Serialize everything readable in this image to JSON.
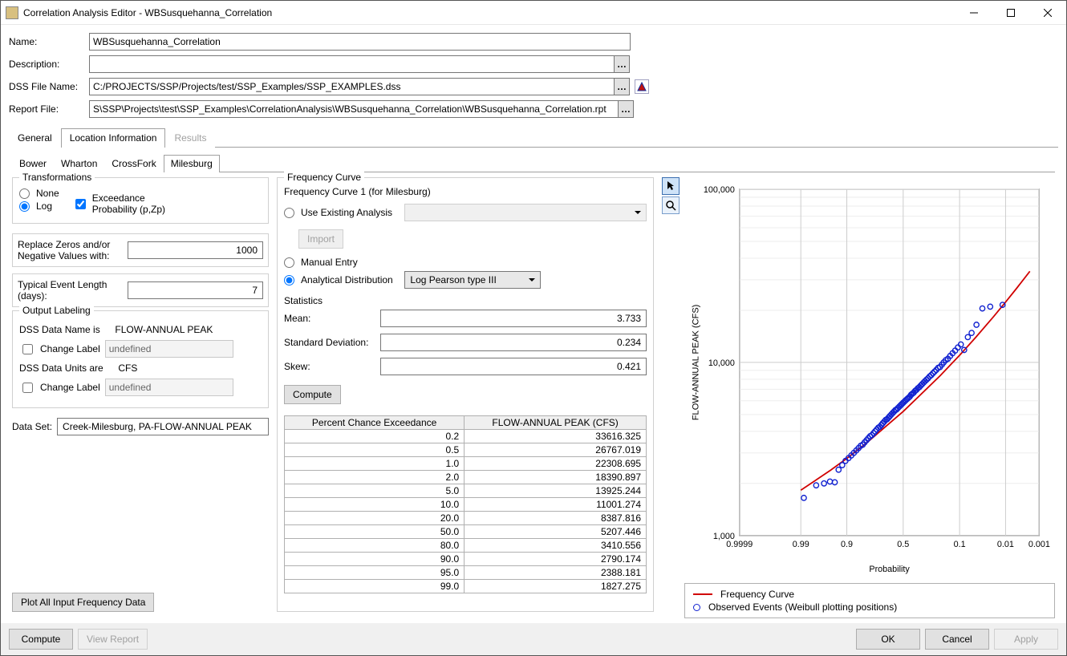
{
  "window": {
    "title": "Correlation Analysis Editor - WBSusquehanna_Correlation"
  },
  "form": {
    "name_label": "Name:",
    "name_value": "WBSusquehanna_Correlation",
    "desc_label": "Description:",
    "desc_value": "",
    "dss_label": "DSS File Name:",
    "dss_value": "C:/PROJECTS/SSP/Projects/test/SSP_Examples/SSP_EXAMPLES.dss",
    "report_label": "Report File:",
    "report_value": "S\\SSP\\Projects\\test\\SSP_Examples\\CorrelationAnalysis\\WBSusquehanna_Correlation\\WBSusquehanna_Correlation.rpt"
  },
  "tabs": {
    "general": "General",
    "location": "Location Information",
    "results": "Results"
  },
  "subtabs": {
    "bower": "Bower",
    "wharton": "Wharton",
    "crossfork": "CrossFork",
    "milesburg": "Milesburg"
  },
  "transforms": {
    "title": "Transformations",
    "none": "None",
    "log": "Log",
    "exceed_label": "Exceedance\nProbability (p,Zp)"
  },
  "replace": {
    "label": "Replace Zeros and/or Negative Values with:",
    "value": "1000"
  },
  "typical": {
    "label": "Typical Event Length (days):",
    "value": "7"
  },
  "outlabel": {
    "title": "Output Labeling",
    "name_is": "DSS Data Name is",
    "name_val": "FLOW-ANNUAL PEAK",
    "units_are": "DSS Data Units are",
    "units_val": "CFS",
    "change": "Change Label",
    "undefined": "undefined"
  },
  "dataset": {
    "label": "Data Set:",
    "value": "Creek-Milesburg, PA-FLOW-ANNUAL PEAK"
  },
  "plot_all_btn": "Plot All Input Frequency Data",
  "freq": {
    "title": "Frequency Curve",
    "curve1": "Frequency Curve 1 (for Milesburg)",
    "use_existing": "Use Existing Analysis",
    "import": "Import",
    "manual": "Manual Entry",
    "analytical": "Analytical Distribution",
    "dist_value": "Log Pearson type III",
    "stats": "Statistics",
    "mean": "Mean:",
    "mean_v": "3.733",
    "sd": "Standard Deviation:",
    "sd_v": "0.234",
    "skew": "Skew:",
    "skew_v": "0.421",
    "compute": "Compute",
    "col1": "Percent Chance Exceedance",
    "col2": "FLOW-ANNUAL PEAK (CFS)",
    "rows": [
      {
        "p": "0.2",
        "v": "33616.325"
      },
      {
        "p": "0.5",
        "v": "26767.019"
      },
      {
        "p": "1.0",
        "v": "22308.695"
      },
      {
        "p": "2.0",
        "v": "18390.897"
      },
      {
        "p": "5.0",
        "v": "13925.244"
      },
      {
        "p": "10.0",
        "v": "11001.274"
      },
      {
        "p": "20.0",
        "v": "8387.816"
      },
      {
        "p": "50.0",
        "v": "5207.446"
      },
      {
        "p": "80.0",
        "v": "3410.556"
      },
      {
        "p": "90.0",
        "v": "2790.174"
      },
      {
        "p": "95.0",
        "v": "2388.181"
      },
      {
        "p": "99.0",
        "v": "1827.275"
      }
    ]
  },
  "chart": {
    "ylabel": "FLOW-ANNUAL PEAK (CFS)",
    "xlabel": "Probability",
    "yticks": [
      "100,000",
      "10,000",
      "1,000"
    ],
    "xticks": [
      "0.9999",
      "0.99",
      "0.9",
      "0.5",
      "0.1",
      "0.01",
      "0.001"
    ],
    "legend1": "Frequency Curve",
    "legend2": "Observed Events (Weibull plotting positions)"
  },
  "footer": {
    "compute": "Compute",
    "view": "View Report",
    "ok": "OK",
    "cancel": "Cancel",
    "apply": "Apply"
  },
  "chart_data": {
    "type": "line+scatter",
    "title": "",
    "xlabel": "Probability",
    "ylabel": "FLOW-ANNUAL PEAK (CFS)",
    "x_scale": "normal_probability",
    "y_scale": "log",
    "ylim": [
      1000,
      100000
    ],
    "xlim": [
      0.9999,
      0.001
    ],
    "xticks": [
      0.9999,
      0.99,
      0.9,
      0.5,
      0.1,
      0.01,
      0.001
    ],
    "series": [
      {
        "name": "Frequency Curve",
        "type": "line",
        "color": "#d00000",
        "x": [
          0.99,
          0.95,
          0.9,
          0.8,
          0.5,
          0.2,
          0.1,
          0.05,
          0.02,
          0.01,
          0.005,
          0.002
        ],
        "y": [
          1827.275,
          2388.181,
          2790.174,
          3410.556,
          5207.446,
          8387.816,
          11001.274,
          13925.244,
          18390.897,
          22308.695,
          26767.019,
          33616.325
        ]
      },
      {
        "name": "Observed Events (Weibull plotting positions)",
        "type": "scatter",
        "color": "#1020d0",
        "x": [
          0.988,
          0.976,
          0.964,
          0.952,
          0.94,
          0.929,
          0.917,
          0.905,
          0.893,
          0.881,
          0.869,
          0.857,
          0.845,
          0.833,
          0.821,
          0.81,
          0.798,
          0.786,
          0.774,
          0.762,
          0.75,
          0.738,
          0.726,
          0.714,
          0.702,
          0.69,
          0.679,
          0.667,
          0.655,
          0.643,
          0.631,
          0.619,
          0.607,
          0.595,
          0.583,
          0.571,
          0.56,
          0.548,
          0.536,
          0.524,
          0.512,
          0.5,
          0.488,
          0.476,
          0.464,
          0.452,
          0.44,
          0.429,
          0.417,
          0.405,
          0.393,
          0.381,
          0.369,
          0.357,
          0.345,
          0.333,
          0.321,
          0.31,
          0.298,
          0.286,
          0.274,
          0.262,
          0.25,
          0.238,
          0.226,
          0.214,
          0.202,
          0.19,
          0.179,
          0.167,
          0.155,
          0.143,
          0.131,
          0.119,
          0.107,
          0.095,
          0.083,
          0.071,
          0.06,
          0.048,
          0.036,
          0.024,
          0.012
        ],
        "y": [
          1650,
          1950,
          2000,
          2050,
          2030,
          2400,
          2550,
          2700,
          2800,
          2900,
          3000,
          3100,
          3200,
          3300,
          3350,
          3450,
          3550,
          3650,
          3750,
          3800,
          3900,
          4000,
          4100,
          4200,
          4250,
          4350,
          4450,
          4550,
          4650,
          4700,
          4800,
          4900,
          5000,
          5100,
          5200,
          5300,
          5350,
          5450,
          5550,
          5650,
          5750,
          5850,
          5950,
          6050,
          6150,
          6250,
          6350,
          6500,
          6600,
          6700,
          6850,
          6950,
          7100,
          7200,
          7350,
          7500,
          7650,
          7800,
          7950,
          8100,
          8300,
          8450,
          8650,
          8850,
          9050,
          9300,
          9400,
          9700,
          10000,
          10300,
          10500,
          10900,
          11300,
          11700,
          12200,
          12700,
          11800,
          14000,
          14800,
          16500,
          20500,
          21000,
          21500
        ]
      }
    ]
  }
}
